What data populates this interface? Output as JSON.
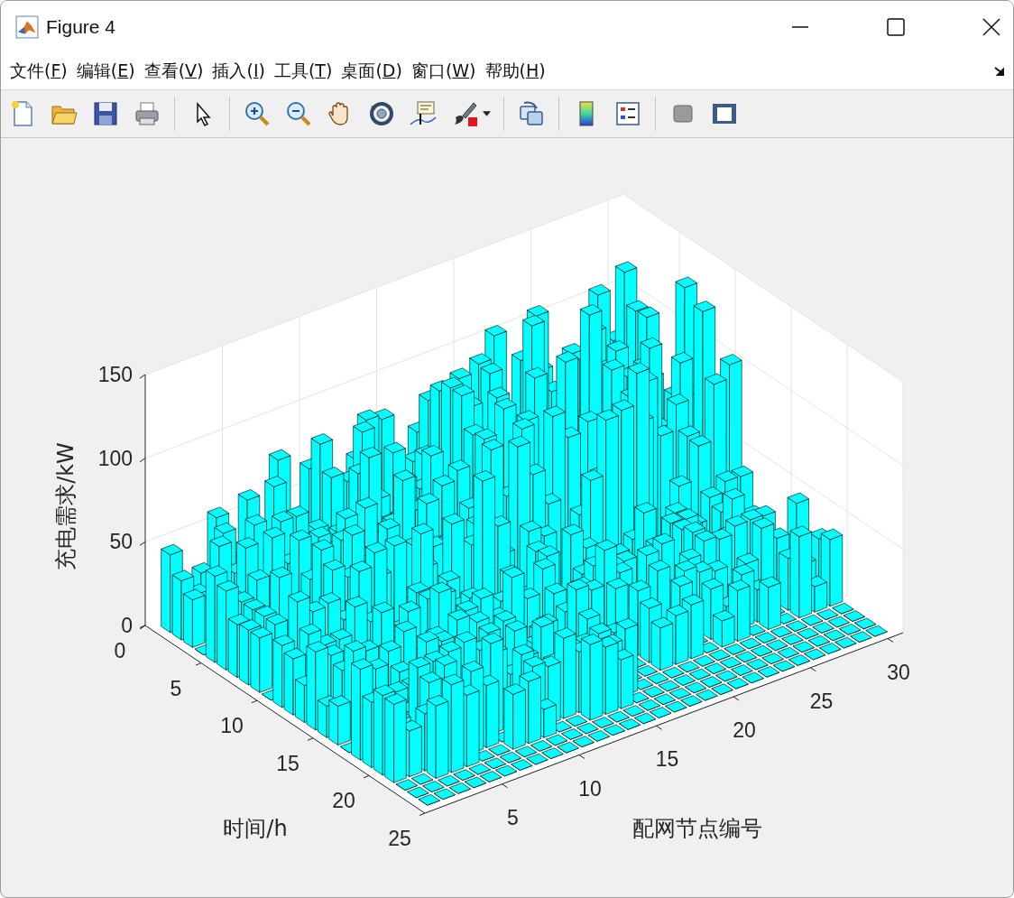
{
  "window": {
    "title": "Figure 4"
  },
  "menu": [
    {
      "label": "文件(",
      "key": "F",
      "suffix": ")"
    },
    {
      "label": "编辑(",
      "key": "E",
      "suffix": ")"
    },
    {
      "label": "查看(",
      "key": "V",
      "suffix": ")"
    },
    {
      "label": "插入(",
      "key": "I",
      "suffix": ")"
    },
    {
      "label": "工具(",
      "key": "T",
      "suffix": ")"
    },
    {
      "label": "桌面(",
      "key": "D",
      "suffix": ")"
    },
    {
      "label": "窗口(",
      "key": "W",
      "suffix": ")"
    },
    {
      "label": "帮助(",
      "key": "H",
      "suffix": ")"
    }
  ],
  "axes": {
    "zlabel": "充电需求/kW",
    "zticks": [
      "150",
      "100",
      "50",
      "0"
    ],
    "ylabel": "时间/h",
    "yticks": [
      "0",
      "5",
      "10",
      "15",
      "20",
      "25"
    ],
    "xlabel": "配网节点编号",
    "xticks": [
      "5",
      "10",
      "15",
      "20",
      "25",
      "30"
    ]
  }
}
